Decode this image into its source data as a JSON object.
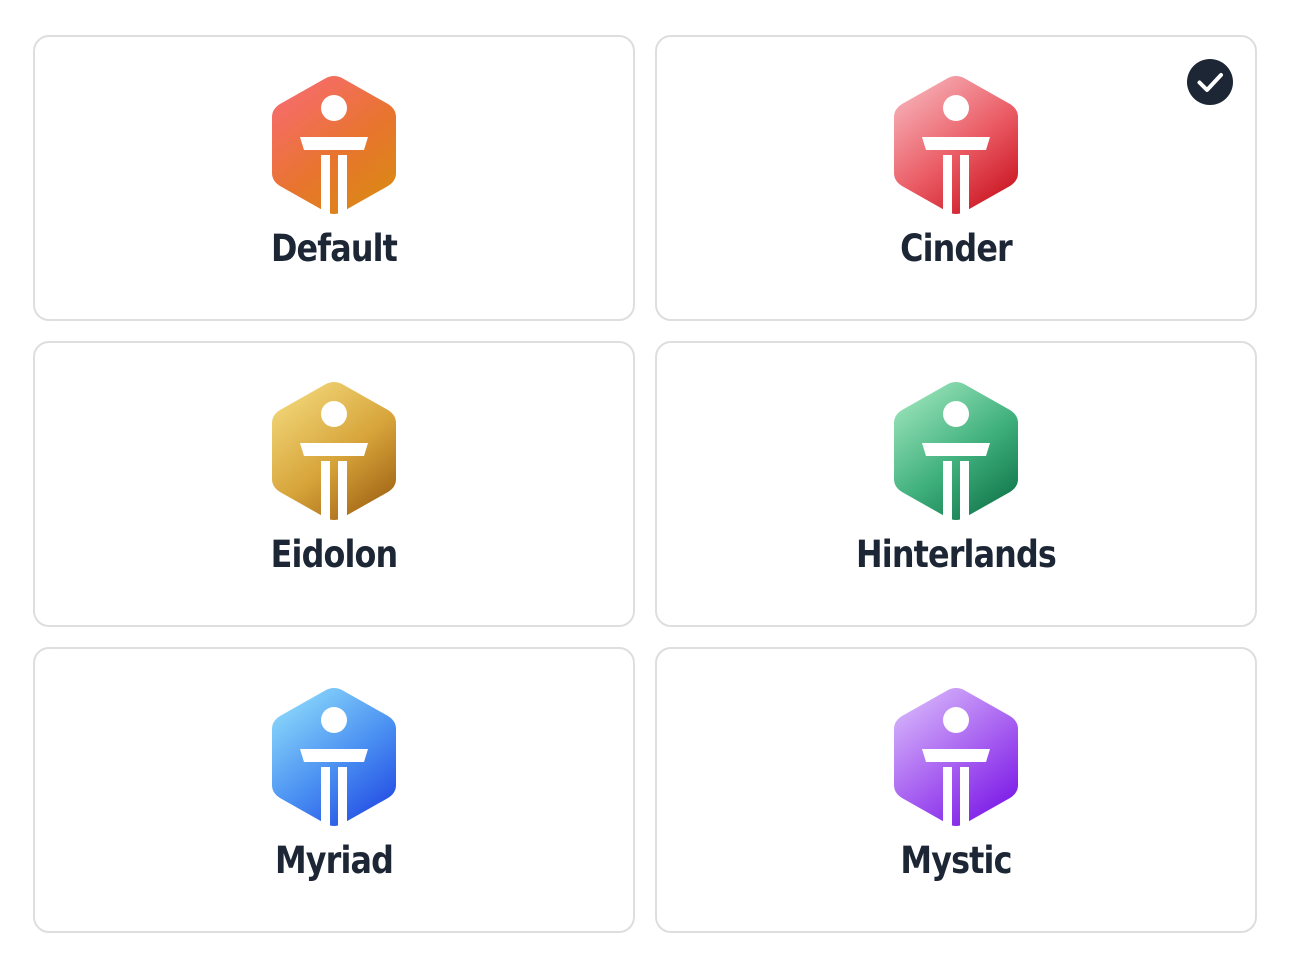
{
  "themes": [
    {
      "label": "Default",
      "selected": false,
      "icon": "hexagon-pillar-icon",
      "colors": [
        "#f86b72",
        "#e8742f",
        "#d98a12"
      ]
    },
    {
      "label": "Cinder",
      "selected": true,
      "icon": "hexagon-pillar-icon",
      "colors": [
        "#f7b5bc",
        "#ea5a63",
        "#c7101d"
      ]
    },
    {
      "label": "Eidolon",
      "selected": false,
      "icon": "hexagon-pillar-icon",
      "colors": [
        "#f3d97c",
        "#d7a43a",
        "#9e6012"
      ]
    },
    {
      "label": "Hinterlands",
      "selected": false,
      "icon": "hexagon-pillar-icon",
      "colors": [
        "#9fe6bd",
        "#3fb07c",
        "#0f7349"
      ]
    },
    {
      "label": "Myriad",
      "selected": false,
      "icon": "hexagon-pillar-icon",
      "colors": [
        "#8fdcfb",
        "#4a90f2",
        "#2148e3"
      ]
    },
    {
      "label": "Mystic",
      "selected": false,
      "icon": "hexagon-pillar-icon",
      "colors": [
        "#d8b8fb",
        "#a55cf0",
        "#7714e6"
      ]
    }
  ],
  "selected_icon": "check-circle-icon",
  "colors": {
    "label_text": "#1c2634",
    "card_border": "#dedede",
    "check_bg": "#1c2634"
  }
}
